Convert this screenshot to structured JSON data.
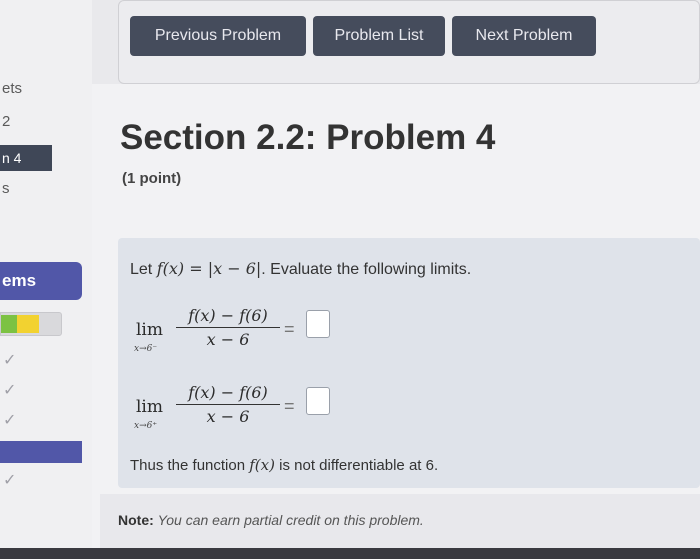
{
  "sidebar": {
    "partial_texts": [
      "ets",
      "2",
      "n 4",
      "s"
    ],
    "section_heading": "ems",
    "progress": {
      "green_fraction": 0.25,
      "yellow_fraction": 0.35
    },
    "check_marks": [
      "✓",
      "✓",
      "✓",
      "✓"
    ]
  },
  "nav": {
    "previous": "Previous Problem",
    "list": "Problem List",
    "next": "Next Problem"
  },
  "header": {
    "title": "Section 2.2: Problem 4",
    "points": "(1 point)"
  },
  "problem": {
    "intro_prefix": "Let ",
    "function_def": "f(x) = |x − 6|",
    "intro_suffix": ". Evaluate the following limits.",
    "limits": [
      {
        "lim": "lim",
        "approach": "x→6⁻",
        "numerator": "f(x) − f(6)",
        "denominator": "x − 6",
        "equals": "="
      },
      {
        "lim": "lim",
        "approach": "x→6⁺",
        "numerator": "f(x) − f(6)",
        "denominator": "x − 6",
        "equals": "="
      }
    ],
    "conclusion_prefix": "Thus the function ",
    "conclusion_func": "f(x)",
    "conclusion_suffix": " is not differentiable at 6."
  },
  "note": {
    "label": "Note:",
    "text": "You can earn partial credit on this problem."
  }
}
